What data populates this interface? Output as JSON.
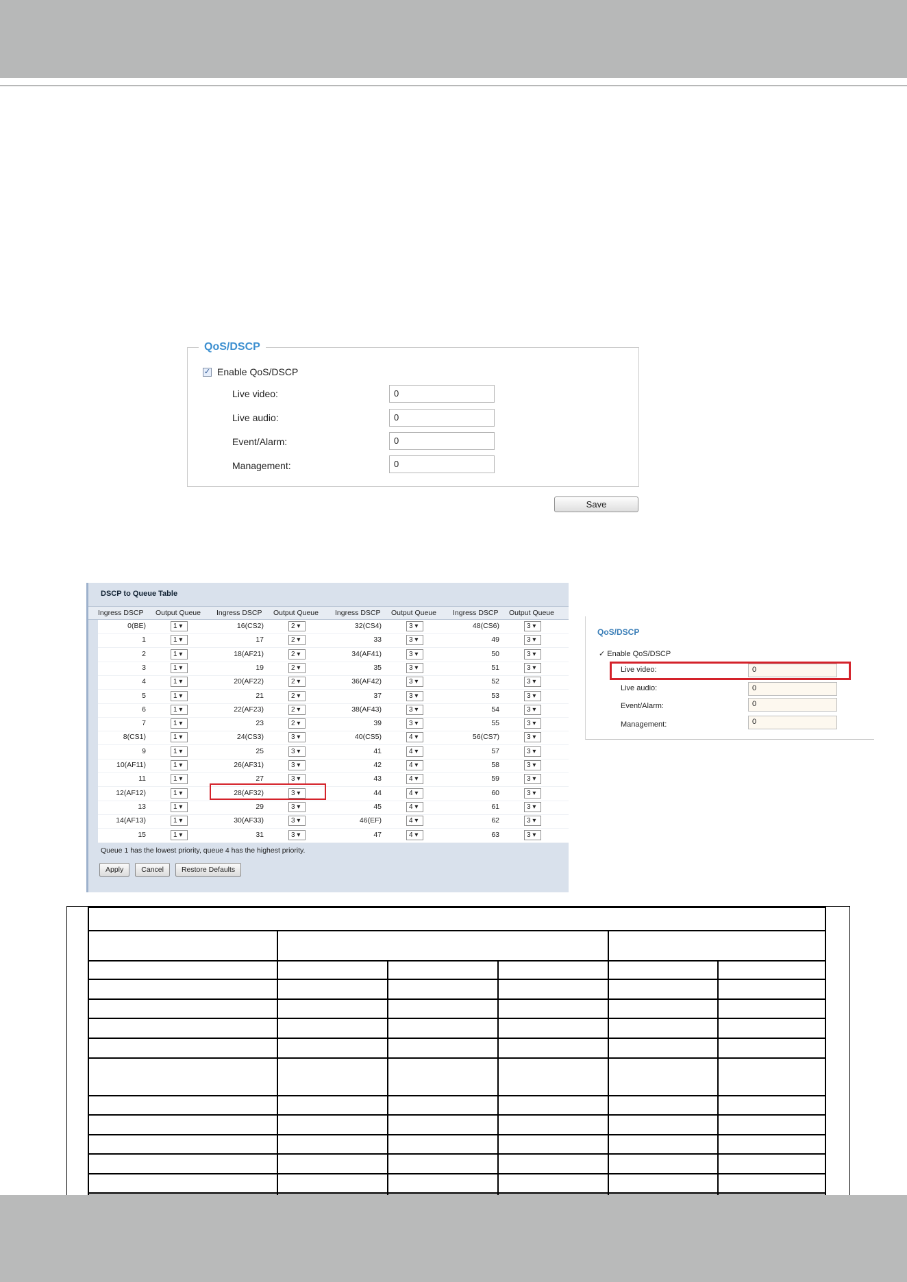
{
  "qos_panel": {
    "title": "QoS/DSCP",
    "enable_label": "Enable QoS/DSCP",
    "enabled": true,
    "fields": [
      {
        "label": "Live video:",
        "value": "0"
      },
      {
        "label": "Live audio:",
        "value": "0"
      },
      {
        "label": "Event/Alarm:",
        "value": "0"
      },
      {
        "label": "Management:",
        "value": "0"
      }
    ],
    "save_label": "Save"
  },
  "dscp_table": {
    "title": "DSCP to Queue Table",
    "headers": [
      "Ingress DSCP",
      "Output Queue",
      "Ingress DSCP",
      "Output Queue",
      "Ingress DSCP",
      "Output Queue",
      "Ingress DSCP",
      "Output Queue"
    ],
    "rows": [
      [
        "0(BE)",
        "1",
        "16(CS2)",
        "2",
        "32(CS4)",
        "3",
        "48(CS6)",
        "3"
      ],
      [
        "1",
        "1",
        "17",
        "2",
        "33",
        "3",
        "49",
        "3"
      ],
      [
        "2",
        "1",
        "18(AF21)",
        "2",
        "34(AF41)",
        "3",
        "50",
        "3"
      ],
      [
        "3",
        "1",
        "19",
        "2",
        "35",
        "3",
        "51",
        "3"
      ],
      [
        "4",
        "1",
        "20(AF22)",
        "2",
        "36(AF42)",
        "3",
        "52",
        "3"
      ],
      [
        "5",
        "1",
        "21",
        "2",
        "37",
        "3",
        "53",
        "3"
      ],
      [
        "6",
        "1",
        "22(AF23)",
        "2",
        "38(AF43)",
        "3",
        "54",
        "3"
      ],
      [
        "7",
        "1",
        "23",
        "2",
        "39",
        "3",
        "55",
        "3"
      ],
      [
        "8(CS1)",
        "1",
        "24(CS3)",
        "3",
        "40(CS5)",
        "4",
        "56(CS7)",
        "3"
      ],
      [
        "9",
        "1",
        "25",
        "3",
        "41",
        "4",
        "57",
        "3"
      ],
      [
        "10(AF11)",
        "1",
        "26(AF31)",
        "3",
        "42",
        "4",
        "58",
        "3"
      ],
      [
        "11",
        "1",
        "27",
        "3",
        "43",
        "4",
        "59",
        "3"
      ],
      [
        "12(AF12)",
        "1",
        "28(AF32)",
        "3",
        "44",
        "4",
        "60",
        "3"
      ],
      [
        "13",
        "1",
        "29",
        "3",
        "45",
        "4",
        "61",
        "3"
      ],
      [
        "14(AF13)",
        "1",
        "30(AF33)",
        "3",
        "46(EF)",
        "4",
        "62",
        "3"
      ],
      [
        "15",
        "1",
        "31",
        "3",
        "47",
        "4",
        "63",
        "3"
      ]
    ],
    "note": "Queue 1 has the lowest priority, queue 4 has the highest priority.",
    "buttons": [
      "Apply",
      "Cancel",
      "Restore Defaults"
    ]
  },
  "qos_panel_small": {
    "title": "QoS/DSCP",
    "enable_label": "Enable QoS/DSCP",
    "fields": [
      {
        "label": "Live video:",
        "value": "0"
      },
      {
        "label": "Live audio:",
        "value": "0"
      },
      {
        "label": "Event/Alarm:",
        "value": "0"
      },
      {
        "label": "Management:",
        "value": "0"
      }
    ]
  }
}
